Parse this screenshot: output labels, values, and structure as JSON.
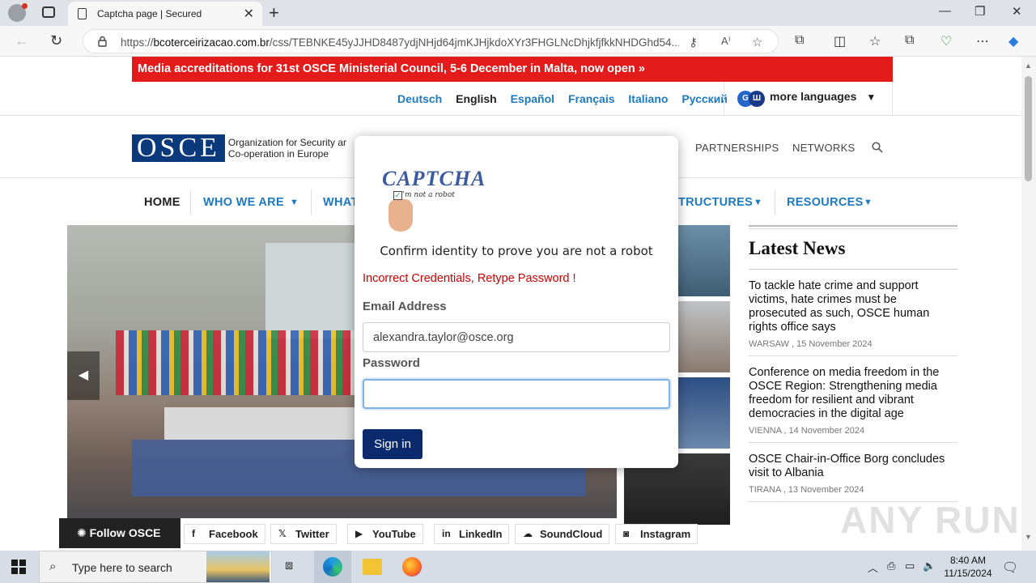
{
  "browser": {
    "tab_title": "Captcha page | Secured",
    "url_host": "bcoterceirizacao.com.br",
    "url_prefix": "https://",
    "url_rest": "/css/TEBNKE45yJJHD8487ydjNHjd64jmKJHjkdoXYr3FHGLNcDhjkfjfkkNHDGhd54..."
  },
  "banner": {
    "text": "Media accreditations for 31st OSCE Ministerial Council, 5-6 December in Malta, now open  »"
  },
  "languages": {
    "items": [
      "Deutsch",
      "English",
      "Español",
      "Français",
      "Italiano",
      "Русский"
    ],
    "current": "English",
    "more": "more languages"
  },
  "header": {
    "logo_letters": "OSCE",
    "logo_line1": "Organization for Security ar",
    "logo_line2": "Co-operation in Europe",
    "links": [
      "PARTNERSHIPS",
      "NETWORKS"
    ]
  },
  "mainnav": {
    "home": "HOME",
    "who": "WHO WE ARE",
    "what": "WHAT",
    "structures": "TRUCTURES",
    "resources": "RESOURCES"
  },
  "news": {
    "title": "Latest News",
    "items": [
      {
        "headline": "To tackle hate crime and support victims, hate crimes must be prosecuted as such, OSCE human rights office says",
        "meta": "WARSAW , 15 November 2024"
      },
      {
        "headline": "Conference on media freedom in the OSCE Region: Strengthening media freedom for resilient and vibrant democracies in the digital age",
        "meta": "VIENNA , 14 November 2024"
      },
      {
        "headline": "OSCE Chair-in-Office Borg concludes visit to Albania",
        "meta": "TIRANA , 13 November 2024"
      }
    ]
  },
  "social": {
    "follow": "Follow OSCE",
    "buttons": [
      "Facebook",
      "Twitter",
      "YouTube",
      "LinkedIn",
      "SoundCloud",
      "Instagram"
    ]
  },
  "modal": {
    "captcha_word": "CAPTCHA",
    "captcha_sub": "I'm not a robot",
    "heading": "Confirm identity to prove you are not a robot",
    "error": "Incorrect Credentials, Retype Password !",
    "email_label": "Email Address",
    "email_value": "alexandra.taylor@osce.org",
    "password_label": "Password",
    "password_value": "",
    "signin_label": "Sign in"
  },
  "watermark": "ANY RUN",
  "taskbar": {
    "search_placeholder": "Type here to search",
    "time": "8:40 AM",
    "date": "11/15/2024"
  },
  "colors": {
    "banner_red": "#e31b1b",
    "osce_blue": "#0b3a7c",
    "link_blue": "#1e7ac0",
    "signin_navy": "#0b2a6e",
    "error_red": "#cc0000"
  }
}
